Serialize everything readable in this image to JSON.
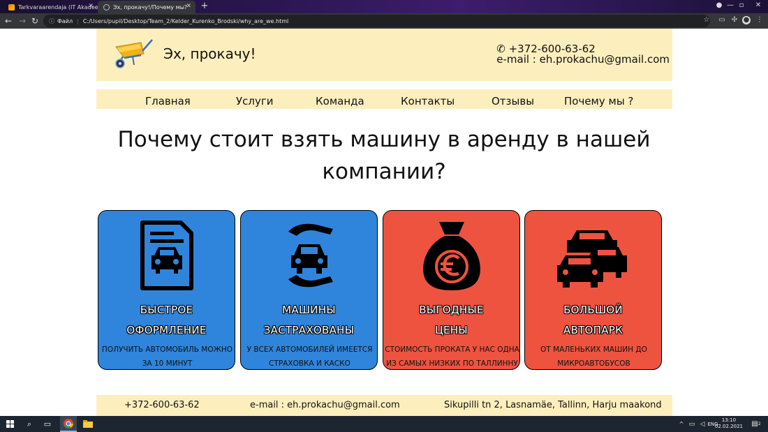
{
  "browser": {
    "tabs": [
      {
        "title": "Tarkvaraarendaja (IT Akadeemia)",
        "active": false
      },
      {
        "title": "Эх, прокачу!/Почему мы?",
        "active": true
      }
    ],
    "address": {
      "prefix": "Файл",
      "url": "C:/Users/pupil/Desktop/Team_2/Kelder_Kurenko_Brodski/why_are_we.html"
    }
  },
  "header": {
    "brand": "Эх, прокачу!",
    "phone": "✆ +372-600-63-62",
    "email": "e-mail : eh.prokachu@gmail.com"
  },
  "nav": {
    "items": [
      "Главная",
      "Услуги",
      "Команда",
      "Контакты",
      "Отзывы",
      "Почему мы ?"
    ]
  },
  "main": {
    "heading": "Почему стоит взять машину в аренду в нашей компании?",
    "cards": [
      {
        "title_1": "БЫСТРОЕ",
        "title_2": "ОФОРМЛЕНИЕ",
        "desc": "ПОЛУЧИТЬ АВТОМОБИЛЬ МОЖНО ЗА 10 МИНУТ",
        "icon": "document-car-icon",
        "color": "#2f85dc"
      },
      {
        "title_1": "МАШИНЫ",
        "title_2": "ЗАСТРАХОВАНЫ",
        "desc": "У ВСЕХ АВТОМОБИЛЕЙ ИМЕЕТСЯ СТРАХОВКА И КАСКО",
        "icon": "insured-car-hands-icon",
        "color": "#2f85dc"
      },
      {
        "title_1": "ВЫГОДНЫЕ",
        "title_2": "ЦЕНЫ",
        "desc": "СТОИМОСТЬ ПРОКАТА У НАС ОДНА ИЗ САМЫХ НИЗКИХ ПО ТАЛЛИННУ",
        "icon": "euro-money-bag-icon",
        "color": "#ee5340"
      },
      {
        "title_1": "БОЛЬШОЙ",
        "title_2": "АВТОПАРК",
        "desc": "ОТ МАЛЕНЬКИХ МАШИН ДО МИКРОАВТОБУСОВ",
        "icon": "car-fleet-icon",
        "color": "#ee5340"
      }
    ]
  },
  "footer": {
    "phone": "+372-600-63-62",
    "email": "e-mail : eh.prokachu@gmail.com",
    "address": "Sikupilli tn 2, Lasnamäe, Tallinn, Harju maakond"
  },
  "taskbar": {
    "lang": "ENG",
    "time": "13:10",
    "date": "02.02.2021",
    "notifications": "2"
  },
  "colors": {
    "header_bg": "#fdefbd",
    "blue_card": "#2f85dc",
    "red_card": "#ee5340"
  }
}
